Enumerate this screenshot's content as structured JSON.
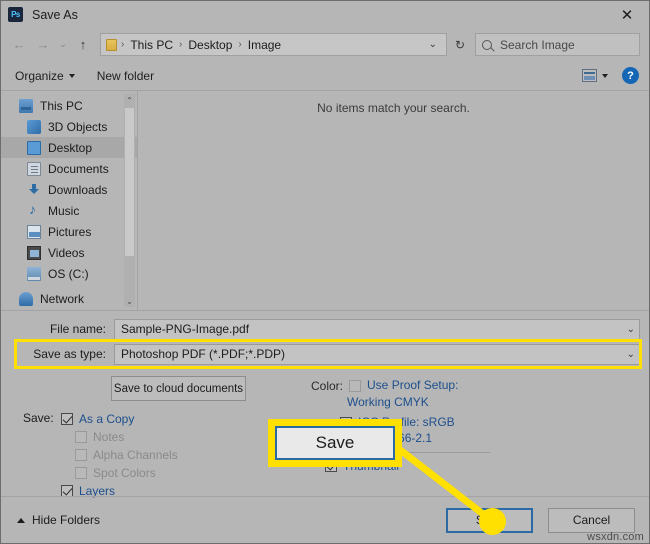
{
  "window": {
    "title": "Save As",
    "app_icon": "Ps",
    "close_label": "✕"
  },
  "navbar": {
    "back_icon": "←",
    "forward_icon": "→",
    "recent_icon": "⌄",
    "up_icon": "↑",
    "breadcrumbs": [
      "This PC",
      "Desktop",
      "Image"
    ],
    "separator": "›",
    "dropdown_icon": "⌄",
    "refresh_icon": "↻",
    "search_placeholder": "Search Image"
  },
  "command_bar": {
    "organize_label": "Organize",
    "new_folder_label": "New folder",
    "help_label": "?"
  },
  "sidebar": {
    "items": [
      {
        "label": "This PC",
        "icon": "pc-icon",
        "selected": false,
        "indent": false
      },
      {
        "label": "3D Objects",
        "icon": "3d-objects-icon",
        "selected": false,
        "indent": true
      },
      {
        "label": "Desktop",
        "icon": "desktop-icon",
        "selected": true,
        "indent": true
      },
      {
        "label": "Documents",
        "icon": "documents-icon",
        "selected": false,
        "indent": true
      },
      {
        "label": "Downloads",
        "icon": "downloads-icon",
        "selected": false,
        "indent": true
      },
      {
        "label": "Music",
        "icon": "music-icon",
        "selected": false,
        "indent": true
      },
      {
        "label": "Pictures",
        "icon": "pictures-icon",
        "selected": false,
        "indent": true
      },
      {
        "label": "Videos",
        "icon": "videos-icon",
        "selected": false,
        "indent": true
      },
      {
        "label": "OS (C:)",
        "icon": "drive-icon",
        "selected": false,
        "indent": true
      },
      {
        "label": "Network",
        "icon": "network-icon",
        "selected": false,
        "indent": false
      }
    ],
    "scroll_up_icon": "⌃",
    "scroll_down_icon": "⌄"
  },
  "file_list": {
    "empty_message": "No items match your search."
  },
  "form": {
    "file_name_label": "File name:",
    "file_name_value": "Sample-PNG-Image.pdf",
    "save_as_type_label": "Save as type:",
    "save_as_type_value": "Photoshop PDF (*.PDF;*.PDP)",
    "chevron": "⌄"
  },
  "options": {
    "cloud_button_label": "Save to cloud documents",
    "save_group_label": "Save:",
    "checkboxes": [
      {
        "label": "As a Copy",
        "checked": true,
        "enabled": true,
        "sub": false
      },
      {
        "label": "Notes",
        "checked": false,
        "enabled": false,
        "sub": true
      },
      {
        "label": "Alpha Channels",
        "checked": false,
        "enabled": false,
        "sub": true
      },
      {
        "label": "Spot Colors",
        "checked": false,
        "enabled": false,
        "sub": true
      },
      {
        "label": "Layers",
        "checked": true,
        "enabled": true,
        "sub": false
      }
    ],
    "color_label": "Color:",
    "proof_setup_label": "Use Proof Setup:",
    "proof_setup_value": "Working CMYK",
    "proof_setup_checked": false,
    "icc_profile_label": "ICC Profile:  sRGB",
    "icc_profile_value": "IEC61966-2.1",
    "icc_profile_checked": true,
    "thumbnail_label": "Thumbnail",
    "thumbnail_checked": true
  },
  "bottom_bar": {
    "hide_folders_label": "Hide Folders",
    "save_label": "Save",
    "cancel_label": "Cancel"
  },
  "annotation": {
    "callout_save_label": "Save",
    "highlight_color": "#ffe000",
    "accent_color": "#2b6aa3"
  },
  "watermark": {
    "text": "wsxdn.com"
  }
}
